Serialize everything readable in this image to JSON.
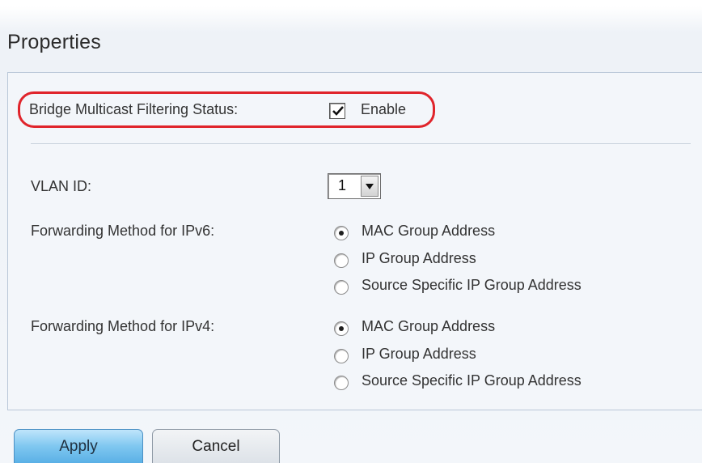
{
  "page": {
    "title": "Properties"
  },
  "filtering": {
    "label": "Bridge Multicast Filtering Status:",
    "checkbox_label": "Enable",
    "checked": true
  },
  "vlan": {
    "label": "VLAN ID:",
    "selected": "1"
  },
  "ipv6": {
    "label": "Forwarding Method for IPv6:",
    "options": [
      {
        "label": "MAC Group Address",
        "selected": true
      },
      {
        "label": "IP Group Address",
        "selected": false
      },
      {
        "label": "Source Specific IP Group Address",
        "selected": false
      }
    ]
  },
  "ipv4": {
    "label": "Forwarding Method for IPv4:",
    "options": [
      {
        "label": "MAC Group Address",
        "selected": true
      },
      {
        "label": "IP Group Address",
        "selected": false
      },
      {
        "label": "Source Specific IP Group Address",
        "selected": false
      }
    ]
  },
  "buttons": {
    "apply": "Apply",
    "cancel": "Cancel"
  },
  "colors": {
    "highlight": "#e0242b",
    "apply_button": "#7fc7f0"
  },
  "icons": {
    "checkbox": "checkmark-icon",
    "dropdown": "triangle-down-icon"
  }
}
